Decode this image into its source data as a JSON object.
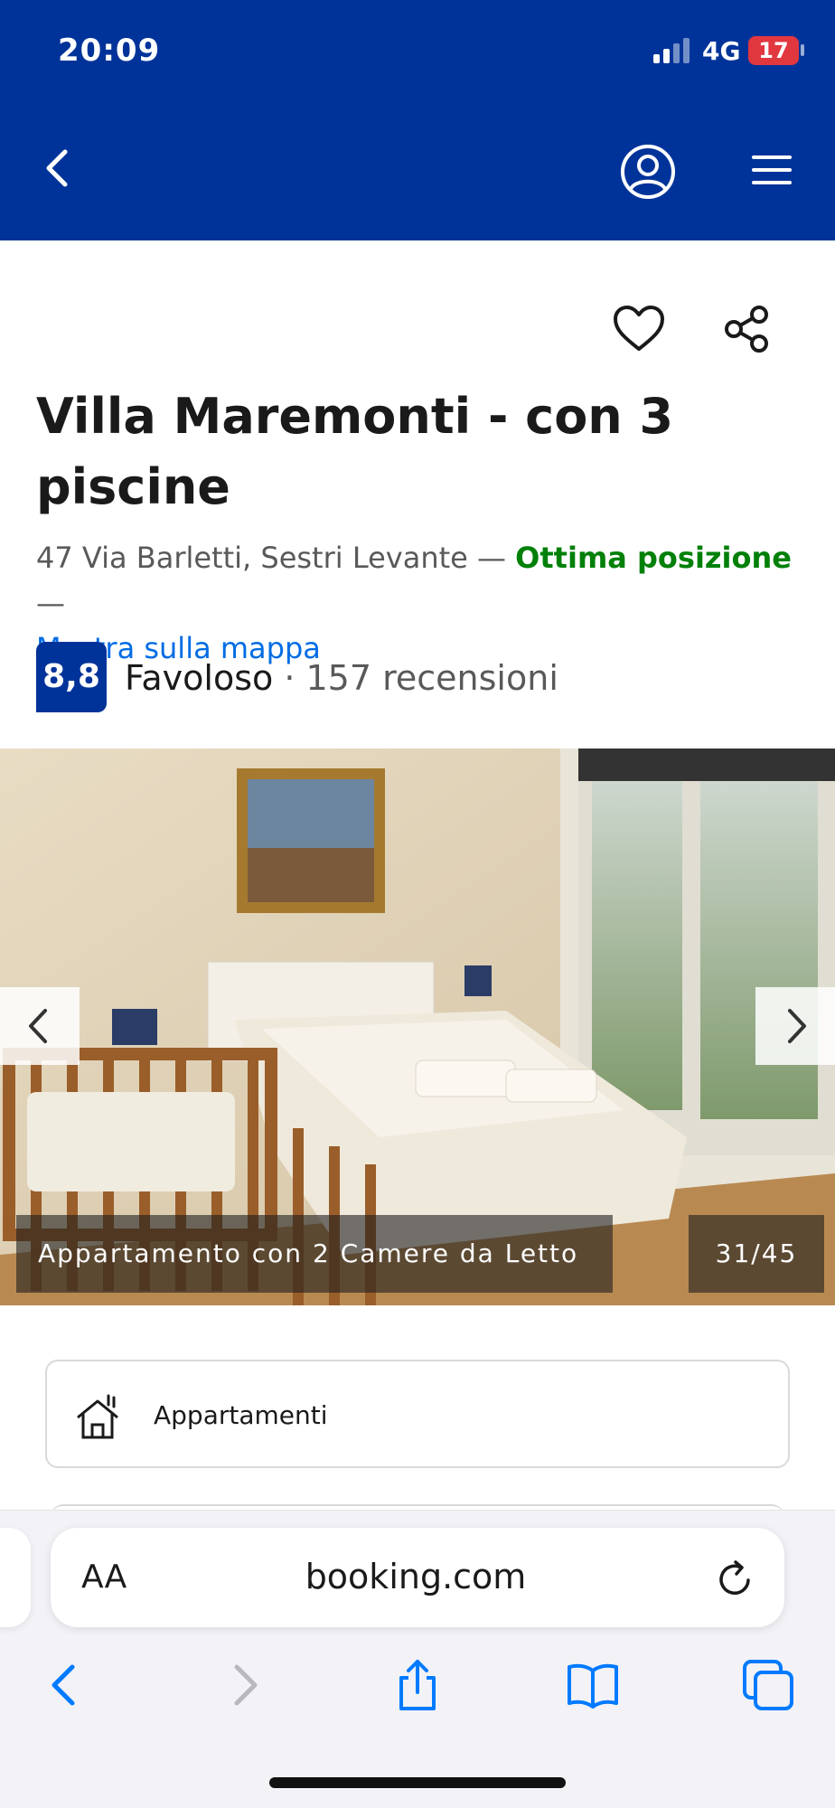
{
  "status_bar": {
    "time": "20:09",
    "network": "4G",
    "battery": "17"
  },
  "header": {
    "back_icon": "chevron-left-icon",
    "account_icon": "user-circle-icon",
    "menu_icon": "hamburger-menu-icon"
  },
  "actions": {
    "save_icon": "heart-icon",
    "share_icon": "share-icon"
  },
  "property": {
    "title": "Villa Maremonti - con 3 piscine",
    "address": "47 Via Barletti, Sestri Levante —",
    "location_badge": "Ottima posizione",
    "separator": "—",
    "map_link": "Mostra sulla mappa",
    "score": "8,8",
    "score_word": "Favoloso",
    "reviews": "· 157 recensioni"
  },
  "gallery": {
    "caption": "Appartamento con 2 Camere da Letto",
    "counter": "31/45",
    "prev_icon": "chevron-left-icon",
    "next_icon": "chevron-right-icon"
  },
  "facility": {
    "label": "Appartamenti",
    "icon": "house-icon"
  },
  "browser": {
    "text_size_label": "AA",
    "url": "booking.com",
    "reload_icon": "reload-icon",
    "toolbar": [
      "back-icon",
      "forward-icon",
      "share-icon",
      "bookmarks-icon",
      "tabs-icon"
    ]
  },
  "colors": {
    "brand": "#003399",
    "link": "#006ce4",
    "positive": "#008009"
  }
}
